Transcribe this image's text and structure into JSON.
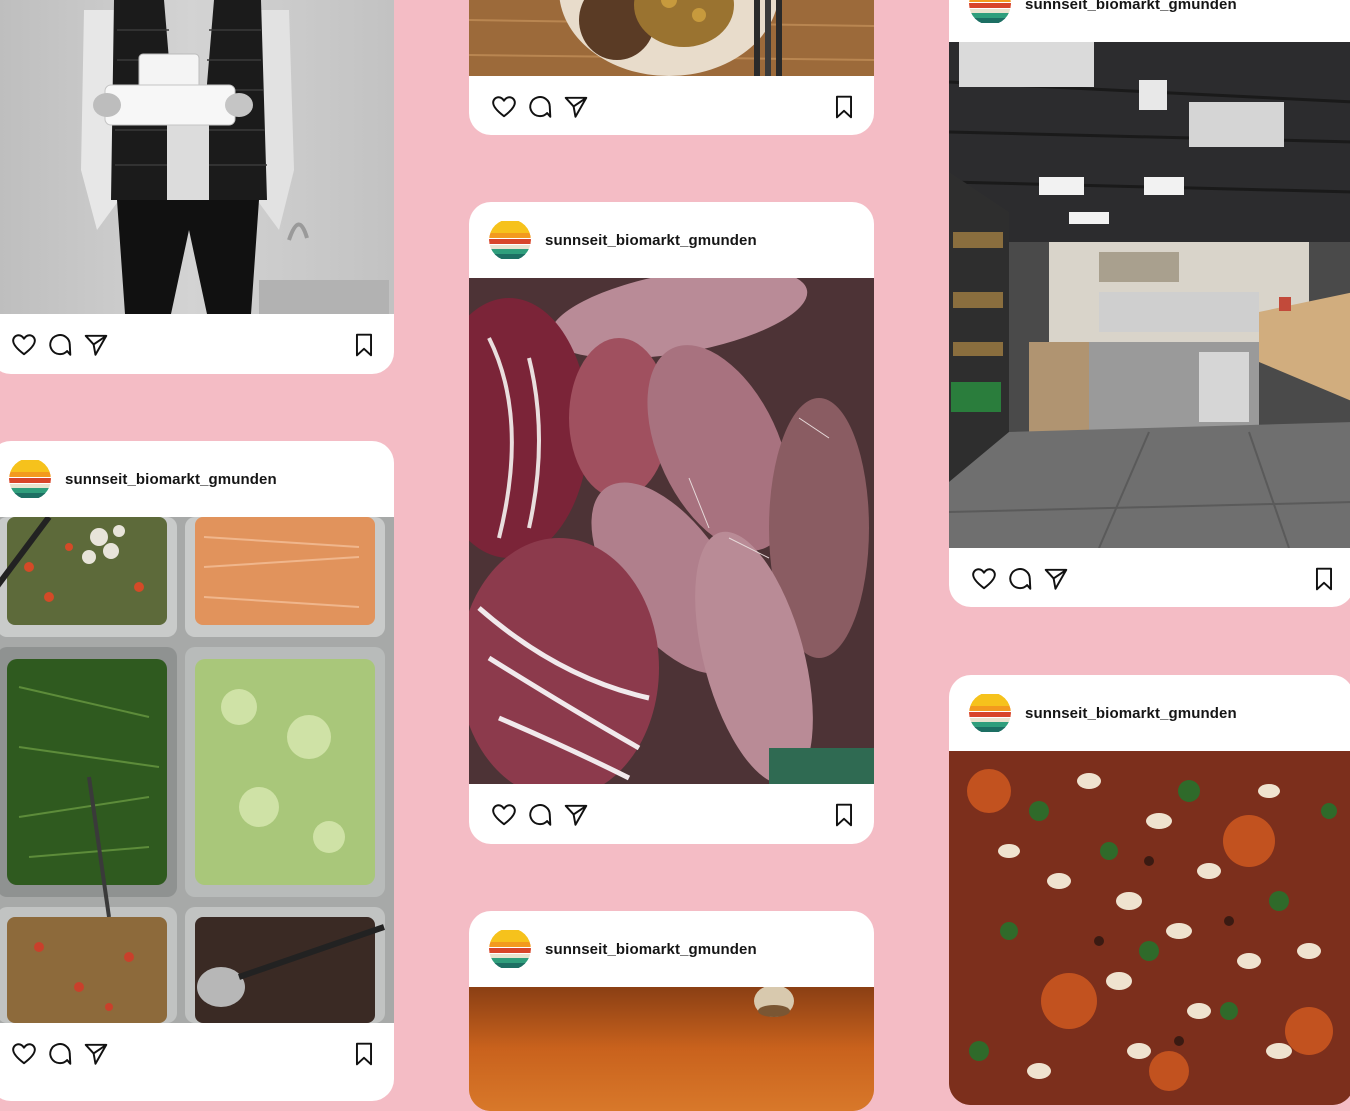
{
  "feed": {
    "brand_colors": {
      "background": "#f4bcc5",
      "card": "#ffffff",
      "logo_stripes": [
        "#f6c21c",
        "#f39a1e",
        "#d8452a",
        "#2f9e7c",
        "#1d6f63"
      ]
    },
    "icons": [
      "like-icon",
      "comment-icon",
      "share-icon",
      "bookmark-icon"
    ],
    "posts": [
      {
        "username": "sunnseit_biomarkt_gmunden",
        "photo": "Salad bar trays with greens, carrots, lentils"
      },
      {
        "username": "sunnseit_biomarkt_gmunden",
        "photo": "Radishes and radicchio"
      },
      {
        "username": "sunnseit_biomarkt_gmunden",
        "photo": "Orange background with nut"
      },
      {
        "username": "sunnseit_biomarkt_gmunden",
        "photo": "Store interior with counter"
      },
      {
        "username": "sunnseit_biomarkt_gmunden",
        "photo": "Curry with cashews and herbs"
      }
    ]
  }
}
